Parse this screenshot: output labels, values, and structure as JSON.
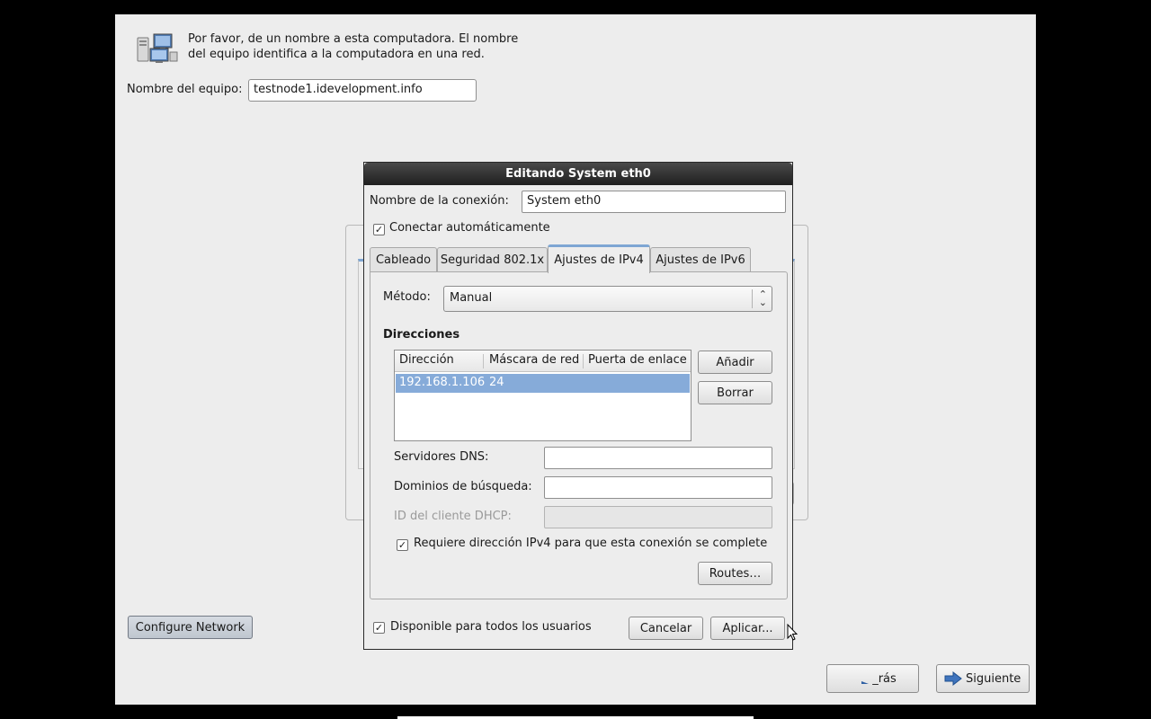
{
  "installer": {
    "intro_line1": "Por favor, de un nombre a esta computadora. El nombre",
    "intro_line2": "del equipo identifica a la computadora en una red.",
    "hostname_label": "Nombre del equipo:",
    "hostname_value": "testnode1.idevelopment.info",
    "configure_network_label": "Configure Network",
    "back_label": "_rás",
    "next_label": "Siguiente"
  },
  "dialog": {
    "title": "Editando System eth0",
    "connection_name_label": "Nombre de la conexión:",
    "connection_name_value": "System eth0",
    "auto_connect_label": "Conectar automáticamente",
    "auto_connect_checked": true,
    "tabs": [
      {
        "label": "Cableado",
        "active": false
      },
      {
        "label": "Seguridad 802.1x",
        "active": false
      },
      {
        "label": "Ajustes de IPv4",
        "active": true
      },
      {
        "label": "Ajustes de IPv6",
        "active": false
      }
    ],
    "method_label": "Método:",
    "method_value": "Manual",
    "addresses_heading": "Direcciones",
    "table_headers": [
      "Dirección",
      "Máscara de red",
      "Puerta de enlace"
    ],
    "table_rows": [
      {
        "address": "192.168.1.106",
        "netmask": "24",
        "gateway": ""
      }
    ],
    "add_button": "Añadir",
    "delete_button": "Borrar",
    "dns_label": "Servidores DNS:",
    "dns_value": "",
    "search_domains_label": "Dominios de búsqueda:",
    "search_domains_value": "",
    "dhcp_client_id_label": "ID del cliente DHCP:",
    "dhcp_client_id_value": "",
    "require_ipv4_label": "Requiere dirección IPv4 para que esta conexión se complete",
    "require_ipv4_checked": true,
    "routes_button": "Routes…",
    "all_users_label": "Disponible para todos los usuarios",
    "all_users_checked": true,
    "cancel_button": "Cancelar",
    "apply_button": "Aplicar..."
  },
  "colors": {
    "selection": "#86abd9",
    "accent": "#7ea6d3",
    "titlebar": "#2a2a2a",
    "window_bg": "#ededed"
  },
  "icons": {
    "host": "network-computers-icon",
    "back": "back-arrow-icon",
    "next": "forward-arrow-icon",
    "combo": "updown-chevron-icon",
    "cursor": "mouse-pointer-icon"
  }
}
